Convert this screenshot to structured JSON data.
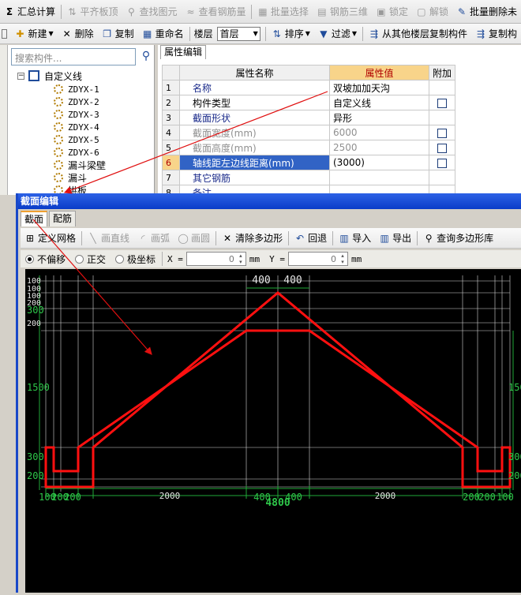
{
  "toolbar1": {
    "sum_label": "汇总计算",
    "align_label": "平齐板顶",
    "find_label": "查找图元",
    "view_rebar_label": "查看钢筋量",
    "batch_select_label": "批量选择",
    "rebar3d_label": "钢筋三维",
    "lock_label": "锁定",
    "unlock_label": "解锁",
    "batch_delete_label": "批量删除未"
  },
  "toolbar2": {
    "new_label": "新建",
    "delete_label": "删除",
    "copy_label": "复制",
    "rename_label": "重命名",
    "floor_label": "楼层",
    "floor_value": "首层",
    "sort_label": "排序",
    "filter_label": "过滤",
    "copy_from_floor_label": "从其他楼层复制构件",
    "copy_to_label": "复制构"
  },
  "leftpane": {
    "search_placeholder": "搜索构件...",
    "root_label": "自定义线",
    "items": [
      "ZDYX-1",
      "ZDYX-2",
      "ZDYX-3",
      "ZDYX-4",
      "ZDYX-5",
      "ZDYX-6",
      "漏斗梁壁",
      "漏斗",
      "拱板"
    ]
  },
  "props": {
    "tab_label": "属性编辑",
    "col_name": "属性名称",
    "col_value": "属性值",
    "col_extra": "附加",
    "rows": [
      {
        "num": "1",
        "name": "名称",
        "value": "双坡加加天沟"
      },
      {
        "num": "2",
        "name": "构件类型",
        "value": "自定义线"
      },
      {
        "num": "3",
        "name": "截面形状",
        "value": "异形"
      },
      {
        "num": "4",
        "name": "截面宽度(mm)",
        "value": "6000"
      },
      {
        "num": "5",
        "name": "截面高度(mm)",
        "value": "2500"
      },
      {
        "num": "6",
        "name": "轴线距左边线距离(mm)",
        "value": "(3000)"
      },
      {
        "num": "7",
        "name": "其它钢筋",
        "value": ""
      },
      {
        "num": "8",
        "name": "备注",
        "value": ""
      }
    ]
  },
  "dialog": {
    "title": "截面编辑",
    "tab_section": "截面",
    "tab_rebar": "配筋",
    "define_grid_label": "定义网格",
    "draw_line_label": "画直线",
    "draw_arc_label": "画弧",
    "draw_circle_label": "画圆",
    "clear_polygon_label": "清除多边形",
    "undo_label": "回退",
    "import_label": "导入",
    "export_label": "导出",
    "query_polygon_lib_label": "查询多边形库",
    "snap_none_label": "不偏移",
    "snap_ortho_label": "正交",
    "snap_polar_label": "极坐标",
    "x_label": "X =",
    "y_label": "Y =",
    "x_value": "0",
    "y_value": "0",
    "unit_x": "mm",
    "unit_y": "mm"
  },
  "drawing": {
    "top_dims": [
      "400",
      "400"
    ],
    "bottom_dims": [
      "100",
      "200",
      "200",
      "2000",
      "400",
      "400",
      "2000",
      "200",
      "200",
      "100"
    ],
    "total_dim": "4800",
    "left_dims": [
      "100",
      "100",
      "100",
      "200",
      "300",
      "200",
      "1500",
      "300",
      "200"
    ],
    "right_dims": [
      "1500",
      "300",
      "200"
    ],
    "colors": {
      "outline": "#ff1010",
      "grid": "#d8d8d8",
      "dim_text": "#2ec84a",
      "dim_line": "#21a838",
      "label_white": "#e8e8e8"
    }
  }
}
